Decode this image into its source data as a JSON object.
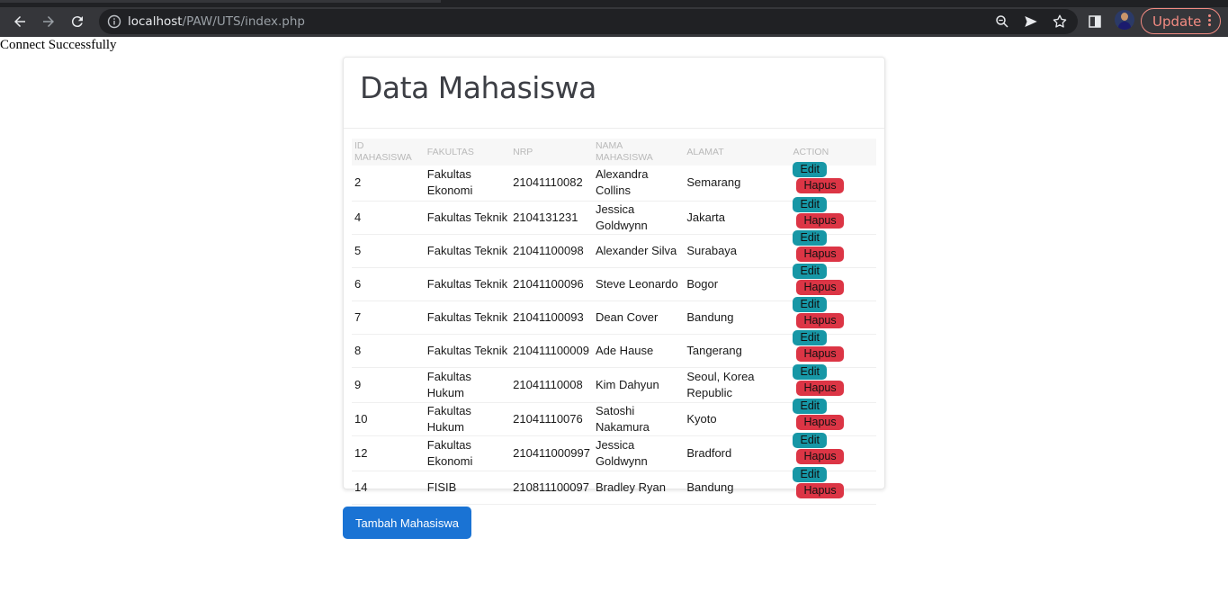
{
  "browser": {
    "url_host": "localhost",
    "url_path": "/PAW/UTS/index.php",
    "update_label": "Update"
  },
  "page": {
    "connect_text": "Connect Successfully",
    "card_title": "Data Mahasiswa",
    "add_button_label": "Tambah Mahasiswa"
  },
  "table": {
    "headers": [
      "ID MAHASISWA",
      "FAKULTAS",
      "NRP",
      "NAMA MAHASISWA",
      "ALAMAT",
      "ACTION"
    ],
    "edit_label": "Edit",
    "delete_label": "Hapus",
    "rows": [
      {
        "id": "2",
        "fakultas": "Fakultas Ekonomi",
        "nrp": "21041110082",
        "nama": "Alexandra Collins",
        "alamat": "Semarang"
      },
      {
        "id": "4",
        "fakultas": "Fakultas Teknik",
        "nrp": "2104131231",
        "nama": "Jessica Goldwynn",
        "alamat": "Jakarta"
      },
      {
        "id": "5",
        "fakultas": "Fakultas Teknik",
        "nrp": "21041100098",
        "nama": "Alexander Silva",
        "alamat": "Surabaya"
      },
      {
        "id": "6",
        "fakultas": "Fakultas Teknik",
        "nrp": "21041100096",
        "nama": "Steve Leonardo",
        "alamat": "Bogor"
      },
      {
        "id": "7",
        "fakultas": "Fakultas Teknik",
        "nrp": "21041100093",
        "nama": "Dean Cover",
        "alamat": "Bandung"
      },
      {
        "id": "8",
        "fakultas": "Fakultas Teknik",
        "nrp": "210411100009",
        "nama": "Ade Hause",
        "alamat": "Tangerang"
      },
      {
        "id": "9",
        "fakultas": "Fakultas Hukum",
        "nrp": "21041110008",
        "nama": "Kim Dahyun",
        "alamat": "Seoul, Korea Republic"
      },
      {
        "id": "10",
        "fakultas": "Fakultas Hukum",
        "nrp": "21041110076",
        "nama": "Satoshi Nakamura",
        "alamat": "Kyoto"
      },
      {
        "id": "12",
        "fakultas": "Fakultas Ekonomi",
        "nrp": "210411000997",
        "nama": "Jessica Goldwynn",
        "alamat": "Bradford"
      },
      {
        "id": "14",
        "fakultas": "FISIB",
        "nrp": "210811100097",
        "nama": "Bradley Ryan",
        "alamat": "Bandung"
      }
    ]
  },
  "colors": {
    "edit_button": "#1797a6",
    "delete_button": "#dc3545",
    "primary_button": "#1a73d4"
  }
}
